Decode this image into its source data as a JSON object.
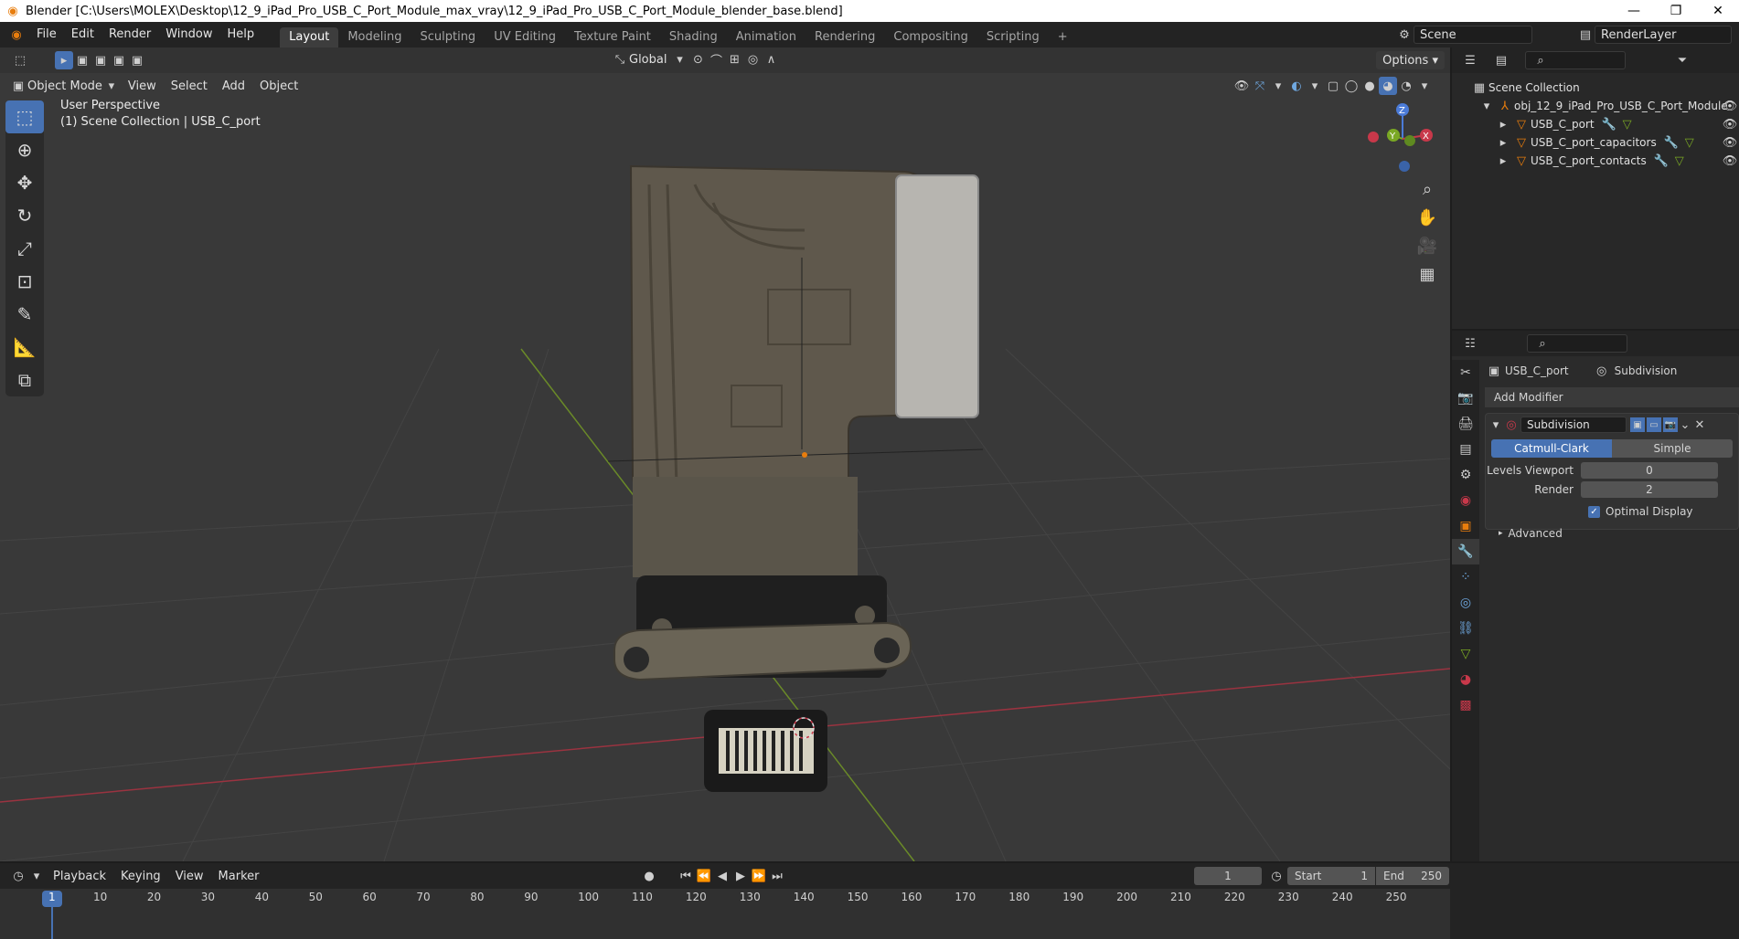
{
  "window": {
    "title": "Blender [C:\\Users\\MOLEX\\Desktop\\12_9_iPad_Pro_USB_C_Port_Module_max_vray\\12_9_iPad_Pro_USB_C_Port_Module_blender_base.blend]",
    "minimize": "—",
    "restore": "❐",
    "close": "✕"
  },
  "topbar": {
    "menus": [
      "File",
      "Edit",
      "Render",
      "Window",
      "Help"
    ],
    "workspaces": [
      "Layout",
      "Modeling",
      "Sculpting",
      "UV Editing",
      "Texture Paint",
      "Shading",
      "Animation",
      "Rendering",
      "Compositing",
      "Scripting"
    ],
    "active_workspace": "Layout",
    "add_tab": "+",
    "scene": "Scene",
    "render_layer": "RenderLayer"
  },
  "viewport": {
    "mode": "Object Mode",
    "menus": [
      "View",
      "Select",
      "Add",
      "Object"
    ],
    "transform_orientation": "Global",
    "options_label": "Options",
    "perspective_label": "User Perspective",
    "collection_label": "(1) Scene Collection | USB_C_port",
    "gizmo": {
      "x": "X",
      "y": "Y",
      "z": "Z"
    }
  },
  "outliner": {
    "root": "Scene Collection",
    "object": "obj_12_9_iPad_Pro_USB_C_Port_Module",
    "children": [
      "USB_C_port",
      "USB_C_port_capacitors",
      "USB_C_port_contacts"
    ]
  },
  "properties": {
    "object_name": "USB_C_port",
    "modifier_name_header": "Subdivision",
    "add_modifier": "Add Modifier",
    "modifier_field": "Subdivision",
    "catmull_clark": "Catmull-Clark",
    "simple": "Simple",
    "levels_viewport_label": "Levels Viewport",
    "levels_viewport_value": "0",
    "render_label": "Render",
    "render_value": "2",
    "optimal_display": "Optimal Display",
    "advanced": "Advanced"
  },
  "timeline": {
    "menus": [
      "Playback",
      "Keying",
      "View",
      "Marker"
    ],
    "current_frame": "1",
    "start_label": "Start",
    "start_value": "1",
    "end_label": "End",
    "end_value": "250",
    "ticks": [
      "1",
      "10",
      "20",
      "30",
      "40",
      "50",
      "60",
      "70",
      "80",
      "90",
      "100",
      "110",
      "120",
      "130",
      "140",
      "150",
      "160",
      "170",
      "180",
      "190",
      "200",
      "210",
      "220",
      "230",
      "240",
      "250"
    ]
  },
  "colors": {
    "accent": "#4772b3",
    "header": "#232323",
    "viewport_bg": "#393939",
    "axis_x": "#c8384a",
    "axis_y": "#7aa824",
    "axis_z": "#4b7bd8"
  }
}
